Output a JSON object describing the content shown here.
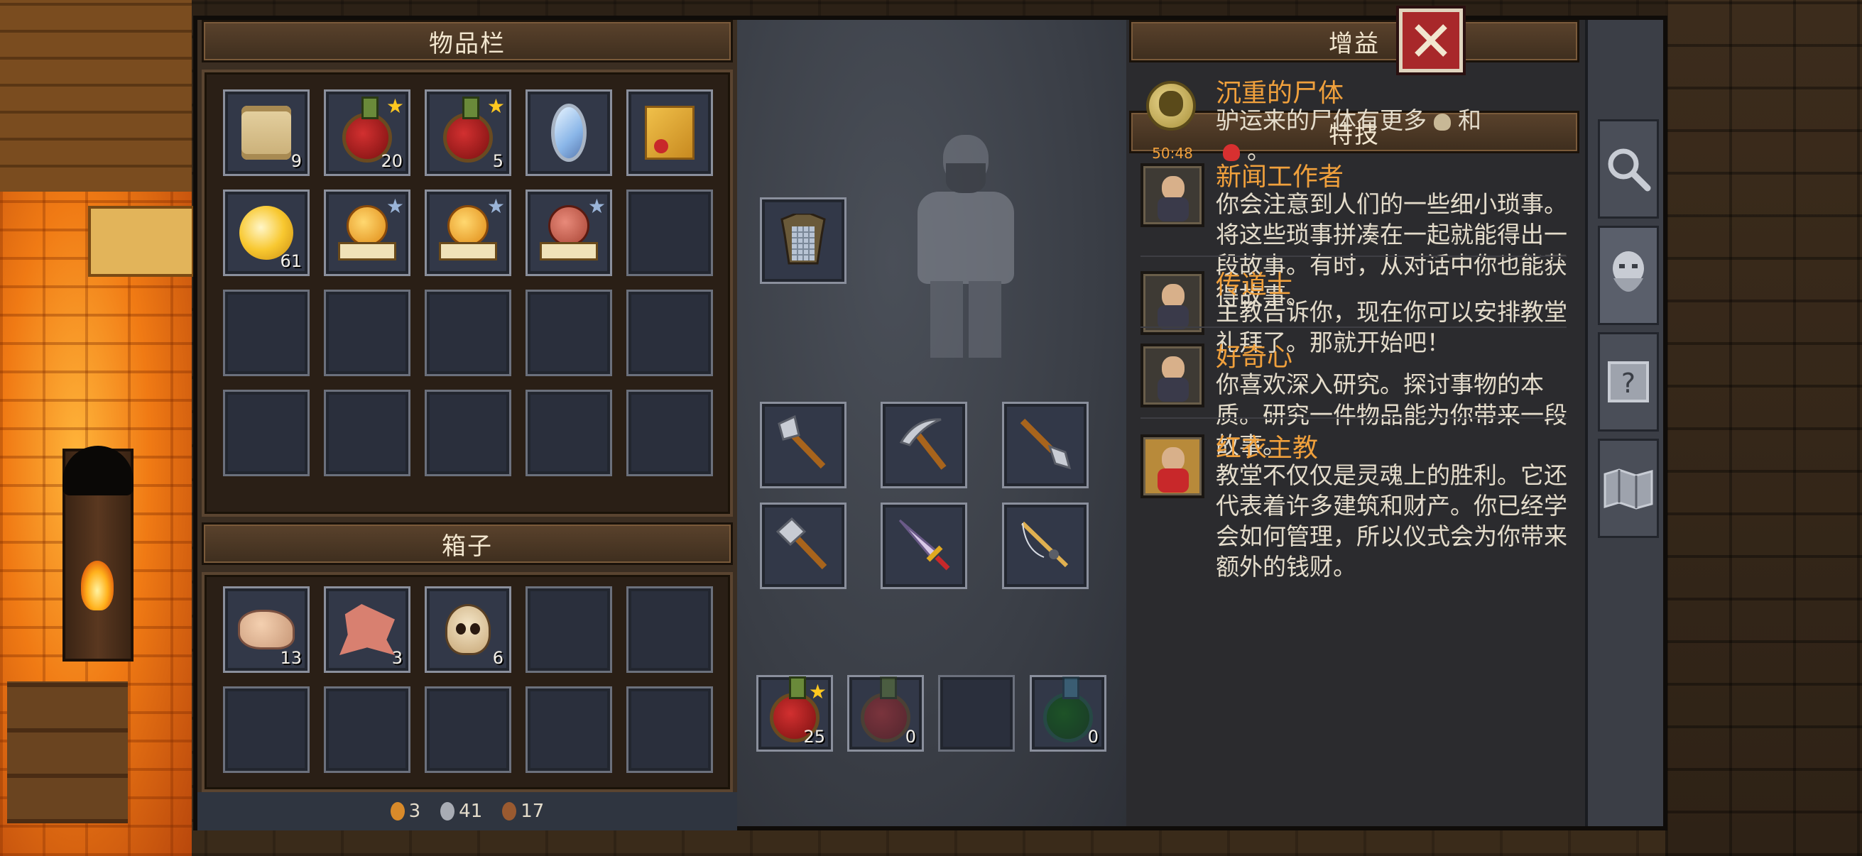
{
  "inventory": {
    "title": "物品栏",
    "slots": [
      {
        "icon": "scroll-icon",
        "qty": "9"
      },
      {
        "icon": "red-potion-icon",
        "qty": "20",
        "star": "gold"
      },
      {
        "icon": "red-potion-icon",
        "qty": "5",
        "star": "gold"
      },
      {
        "icon": "lens-icon",
        "qty": ""
      },
      {
        "icon": "treasure-map-icon",
        "qty": ""
      },
      {
        "icon": "golden-orb-icon",
        "qty": "61"
      },
      {
        "icon": "coin-book-icon",
        "qty": "",
        "star": "silver"
      },
      {
        "icon": "coin-book-icon",
        "qty": "",
        "star": "silver"
      },
      {
        "icon": "church-book-icon",
        "qty": "",
        "star": "silver"
      }
    ]
  },
  "chest": {
    "title": "箱子",
    "slots": [
      {
        "icon": "flesh-icon",
        "qty": "13"
      },
      {
        "icon": "hide-icon",
        "qty": "3"
      },
      {
        "icon": "skull-icon",
        "qty": "6"
      }
    ]
  },
  "currency": {
    "copper": "3",
    "silver": "41",
    "bronze": "17"
  },
  "equipment": {
    "armor_icon": "chainmail-icon",
    "tools": [
      "axe-icon",
      "pickaxe-icon",
      "shovel-icon",
      "hammer-icon",
      "sword-icon",
      "fishing-rod-icon"
    ],
    "quick_slots": [
      {
        "icon": "red-potion-icon",
        "qty": "25",
        "star": "gold"
      },
      {
        "icon": "empty-red-flask-icon",
        "qty": "0"
      },
      {
        "icon": "",
        "qty": ""
      },
      {
        "icon": "empty-green-flask-icon",
        "qty": "0"
      }
    ]
  },
  "buffs": {
    "title": "增益",
    "items": [
      {
        "icon": "skull-coin-icon",
        "timer": "50:48",
        "name": "沉重的尸体",
        "desc_before": "驴运来的尸体有更多",
        "desc_middle": "和",
        "desc_after": "。"
      }
    ]
  },
  "perks": {
    "title": "特技",
    "items": [
      {
        "name": "新闻工作者",
        "desc": "你会注意到人们的一些细小琐事。将这些琐事拼凑在一起就能得出一段故事。有时，从对话中你也能获得故事。"
      },
      {
        "name": "传道士",
        "desc": "主教告诉你，现在你可以安排教堂礼拜了。那就开始吧！"
      },
      {
        "name": "好奇心",
        "desc": "你喜欢深入研究。探讨事物的本质。研究一件物品能为你带来一段故事。"
      },
      {
        "name": "红衣主教",
        "desc": "教堂不仅仅是灵魂上的胜利。它还代表着许多建筑和财产。你已经学会如何管理，所以仪式会为你带来额外的钱财。"
      }
    ]
  },
  "tabs": [
    "magnifier-icon",
    "character-icon",
    "help-icon",
    "map-icon"
  ],
  "colors": {
    "accent": "#f0a03c",
    "close": "#a8282a"
  }
}
